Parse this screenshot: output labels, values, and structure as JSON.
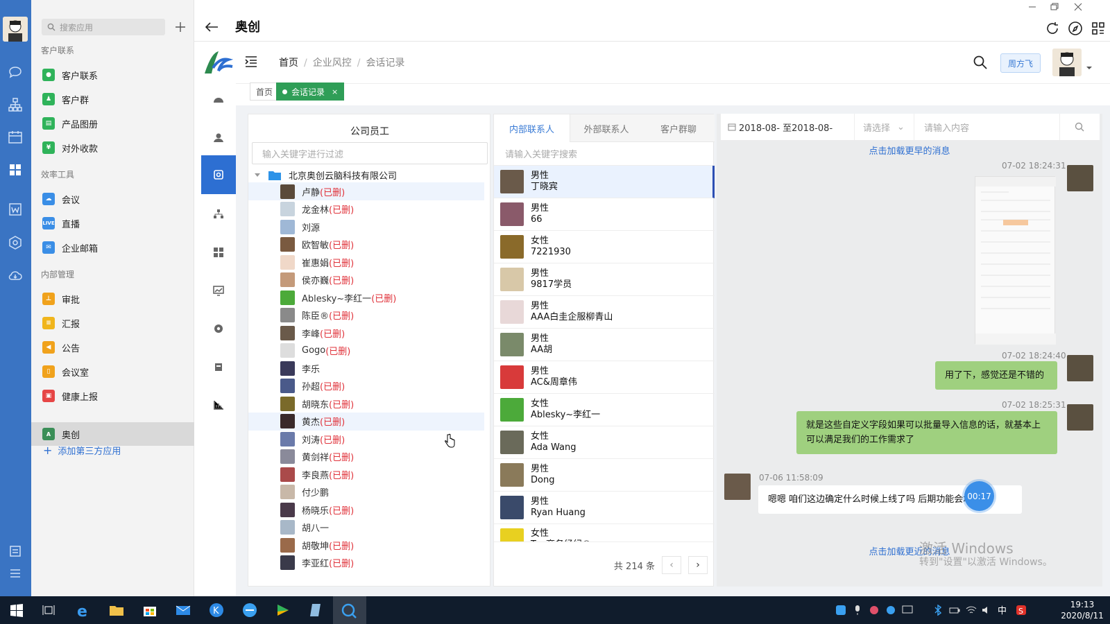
{
  "app": {
    "title": "奥创"
  },
  "apps_panel": {
    "search_placeholder": "搜索应用",
    "groups": [
      "客户联系",
      "效率工具",
      "内部管理"
    ],
    "items": [
      {
        "label": "客户联系",
        "color": "#2fb35a"
      },
      {
        "label": "客户群",
        "color": "#2fb35a"
      },
      {
        "label": "产品图册",
        "color": "#2fb35a"
      },
      {
        "label": "对外收款",
        "color": "#2fb35a"
      },
      {
        "label": "会议",
        "color": "#3a8ee6"
      },
      {
        "label": "直播",
        "color": "#3a8ee6",
        "badge": "LIVE"
      },
      {
        "label": "企业邮箱",
        "color": "#3a8ee6"
      },
      {
        "label": "审批",
        "color": "#f0a21c"
      },
      {
        "label": "汇报",
        "color": "#f0b51c"
      },
      {
        "label": "公告",
        "color": "#f0a21c"
      },
      {
        "label": "会议室",
        "color": "#f0a21c"
      },
      {
        "label": "健康上报",
        "color": "#e64545"
      },
      {
        "label": "奥创",
        "color": "#3a8e57"
      }
    ],
    "add_label": "添加第三方应用"
  },
  "header": {
    "breadcrumb": [
      "首页",
      "企业风控",
      "会话记录"
    ],
    "user_button": "周方飞"
  },
  "page_tabs": {
    "home": "首页",
    "active": "会话记录",
    "close": "×"
  },
  "employees": {
    "title": "公司员工",
    "filter_placeholder": "输入关键字进行过滤",
    "org": "北京奥创云脑科技有限公司",
    "deleted_tag": "(已删)",
    "list": [
      {
        "name": "卢静",
        "deleted": "(已删)",
        "color": "#5a4a3a"
      },
      {
        "name": "龙金林",
        "deleted": "(已删)",
        "color": "#c8d4de"
      },
      {
        "name": "刘源",
        "deleted": "",
        "color": "#9fb8d6"
      },
      {
        "name": "欧智敏",
        "deleted": "(已删)",
        "color": "#7a5a40"
      },
      {
        "name": "崔惠娟",
        "deleted": "(已删)",
        "color": "#f0d8c8"
      },
      {
        "name": "侯亦巍",
        "deleted": "(已删)",
        "color": "#c49a7a"
      },
      {
        "name": "Ablesky~李红一",
        "deleted": "(已删)",
        "color": "#4caa3a"
      },
      {
        "name": "陈臣®",
        "deleted": "(已删)",
        "color": "#8a8a8a"
      },
      {
        "name": "李峰",
        "deleted": "(已删)",
        "color": "#6a5a4a"
      },
      {
        "name": "Gogo",
        "deleted": "(已删)",
        "color": "#dddddd"
      },
      {
        "name": "李乐",
        "deleted": "",
        "color": "#3a3a5a"
      },
      {
        "name": "孙超",
        "deleted": "(已删)",
        "color": "#4a5a8a"
      },
      {
        "name": "胡晓东",
        "deleted": "(已删)",
        "color": "#7a6a2a"
      },
      {
        "name": "黄杰",
        "deleted": "(已删)",
        "color": "#3a2a2a"
      },
      {
        "name": "刘涛",
        "deleted": "(已删)",
        "color": "#6a7aaa"
      },
      {
        "name": "黄剑祥",
        "deleted": "(已删)",
        "color": "#8a8a9a"
      },
      {
        "name": "李良燕",
        "deleted": "(已删)",
        "color": "#aa4a4a"
      },
      {
        "name": "付少鹏",
        "deleted": "",
        "color": "#c8b8a8"
      },
      {
        "name": "杨晓乐",
        "deleted": "(已删)",
        "color": "#4a3a4a"
      },
      {
        "name": "胡八一",
        "deleted": "",
        "color": "#a8b8c8"
      },
      {
        "name": "胡敬坤",
        "deleted": "(已删)",
        "color": "#9a6a4a"
      },
      {
        "name": "李亚红",
        "deleted": "(已删)",
        "color": "#3a3a4a"
      }
    ]
  },
  "contacts": {
    "tabs": [
      "内部联系人",
      "外部联系人",
      "客户群聊"
    ],
    "search_placeholder": "请输入关键字搜索",
    "list": [
      {
        "gender": "男性",
        "name": "丁晓宾",
        "color": "#6a5a4a"
      },
      {
        "gender": "男性",
        "name": "66",
        "color": "#8a5a6a"
      },
      {
        "gender": "女性",
        "name": "7221930",
        "color": "#8a6a2a"
      },
      {
        "gender": "男性",
        "name": "9817学员",
        "color": "#d8c8a8"
      },
      {
        "gender": "男性",
        "name": "AAA白圭企服柳青山",
        "color": "#e8d8d8"
      },
      {
        "gender": "男性",
        "name": "AA胡",
        "color": "#7a8a6a"
      },
      {
        "gender": "男性",
        "name": "AC&周章伟",
        "color": "#d83a3a"
      },
      {
        "gender": "女性",
        "name": "Ablesky~李红一",
        "color": "#4caa3a"
      },
      {
        "gender": "女性",
        "name": "Ada Wang",
        "color": "#6a6a5a"
      },
      {
        "gender": "男性",
        "name": "Dong",
        "color": "#8a7a5a"
      },
      {
        "gender": "男性",
        "name": "Ryan Huang",
        "color": "#3a4a6a"
      },
      {
        "gender": "女性",
        "name": "Top商务经纪®",
        "color": "#e8d020"
      }
    ],
    "total": "共 214 条"
  },
  "chat": {
    "date_range": "2018-08- 至2018-08-",
    "select_placeholder": "请选择",
    "content_placeholder": "请输入内容",
    "load_earlier": "点击加载更早的消息",
    "load_recent": "点击加载更近的消息",
    "messages": [
      {
        "time": "07-02 18:24:31",
        "type": "image"
      },
      {
        "time": "07-02 18:24:40",
        "text": "用了下，感觉还是不错的"
      },
      {
        "time": "07-02 18:25:31",
        "text": "就是这些自定义字段如果可以批量导入信息的话，就基本上可以满足我们的工作需求了"
      },
      {
        "time": "07-06 11:58:09",
        "text": "嗯嗯 咱们这边确定什么时候上线了吗  后期功能会增加"
      }
    ],
    "timer": "00:17"
  },
  "watermark": {
    "line1": "激活 Windows",
    "line2": "转到\"设置\"以激活 Windows。"
  },
  "taskbar": {
    "time": "19:13",
    "date": "2020/8/11",
    "ime": "中"
  }
}
